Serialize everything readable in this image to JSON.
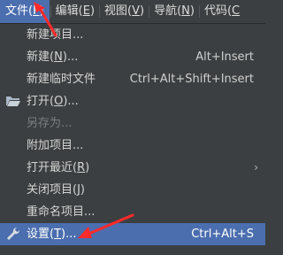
{
  "menubar": {
    "items": [
      {
        "label": "文件(",
        "mn": "F",
        "end": ")",
        "active": true
      },
      {
        "label": "编辑(",
        "mn": "E",
        "end": ")"
      },
      {
        "label": "视图(",
        "mn": "V",
        "end": ")"
      },
      {
        "label": "导航(",
        "mn": "N",
        "end": ")"
      },
      {
        "label": "代码(",
        "mn": "C",
        "end": ""
      }
    ]
  },
  "menu": {
    "items": [
      {
        "label": "新建项目...",
        "shortcut": ""
      },
      {
        "label": "新建(",
        "mn": "N",
        "end": ")...",
        "shortcut": "Alt+Insert"
      },
      {
        "label": "新建临时文件",
        "shortcut": "Ctrl+Alt+Shift+Insert"
      },
      {
        "label": "打开(",
        "mn": "O",
        "end": ")...",
        "shortcut": "",
        "icon": "folder-open-icon"
      },
      {
        "label": "另存为...",
        "shortcut": "",
        "disabled": true
      },
      {
        "label": "附加项目...",
        "shortcut": ""
      },
      {
        "label": "打开最近(",
        "mn": "R",
        "end": ")",
        "shortcut": "",
        "submenu": true
      },
      {
        "label": "关闭项目(",
        "mn": "J",
        "end": ")",
        "shortcut": ""
      },
      {
        "label": "重命名项目...",
        "shortcut": ""
      },
      {
        "label": "设置(",
        "mn": "T",
        "end": ")...",
        "shortcut": "Ctrl+Alt+S",
        "icon": "wrench-icon",
        "selected": true
      }
    ],
    "submenu_arrow": "›"
  },
  "colors": {
    "background": "#3c3f41",
    "selection": "#4b6eaf",
    "annotation_arrow": "#ff2a2a"
  }
}
